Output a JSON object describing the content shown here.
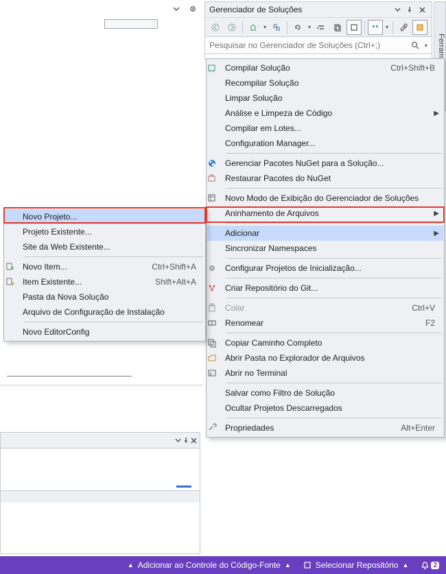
{
  "panel": {
    "title": "Gerenciador de Soluções",
    "search_placeholder": "Pesquisar no Gerenciador de Soluções (Ctrl+;)"
  },
  "side_tab": "Ferramenta de",
  "menu": {
    "items": [
      {
        "label": "Compilar Solução",
        "shortcut": "Ctrl+Shift+B",
        "icon": "build"
      },
      {
        "label": "Recompilar Solução"
      },
      {
        "label": "Limpar Solução"
      },
      {
        "label": "Análise e Limpeza de Código",
        "submenu": true
      },
      {
        "label": "Compilar em Lotes..."
      },
      {
        "label": "Configuration Manager..."
      },
      {
        "sep": true
      },
      {
        "label": "Gerenciar Pacotes NuGet para a Solução...",
        "icon": "nuget"
      },
      {
        "label": "Restaurar Pacotes do NuGet",
        "icon": "restore"
      },
      {
        "sep": true
      },
      {
        "label": "Novo Modo de Exibição do Gerenciador de Soluções",
        "icon": "newview"
      },
      {
        "label": "Aninhamento de Arquivos",
        "submenu": true
      },
      {
        "sep": true
      },
      {
        "label": "Adicionar",
        "submenu": true,
        "highlight": true
      },
      {
        "label": "Sincronizar Namespaces"
      },
      {
        "sep": true
      },
      {
        "label": "Configurar Projetos de Inicialização...",
        "icon": "gear"
      },
      {
        "sep": true
      },
      {
        "label": "Criar Repositório do Git...",
        "icon": "git"
      },
      {
        "sep": true
      },
      {
        "label": "Colar",
        "shortcut": "Ctrl+V",
        "icon": "paste",
        "disabled": true
      },
      {
        "label": "Renomear",
        "shortcut": "F2",
        "icon": "rename"
      },
      {
        "sep": true
      },
      {
        "label": "Copiar Caminho Completo",
        "icon": "copy"
      },
      {
        "label": "Abrir Pasta no Explorador de Arquivos",
        "icon": "folder"
      },
      {
        "label": "Abrir no Terminal",
        "icon": "terminal"
      },
      {
        "sep": true
      },
      {
        "label": "Salvar como Filtro de Solução"
      },
      {
        "label": "Ocultar Projetos Descarregados"
      },
      {
        "sep": true
      },
      {
        "label": "Propriedades",
        "shortcut": "Alt+Enter",
        "icon": "wrench"
      }
    ]
  },
  "submenu": {
    "items": [
      {
        "label": "Novo Projeto...",
        "highlight": true
      },
      {
        "label": "Projeto Existente..."
      },
      {
        "label": "Site da Web Existente..."
      },
      {
        "sep": true
      },
      {
        "label": "Novo Item...",
        "shortcut": "Ctrl+Shift+A",
        "icon": "newitem"
      },
      {
        "label": "Item Existente...",
        "shortcut": "Shift+Alt+A",
        "icon": "existitem"
      },
      {
        "label": "Pasta da Nova Solução"
      },
      {
        "label": "Arquivo de Configuração de Instalação"
      },
      {
        "sep": true
      },
      {
        "label": "Novo EditorConfig"
      }
    ]
  },
  "status": {
    "source_control": "Adicionar ao Controle do Código-Fonte",
    "repo": "Selecionar Repositório",
    "notifications": "2"
  }
}
